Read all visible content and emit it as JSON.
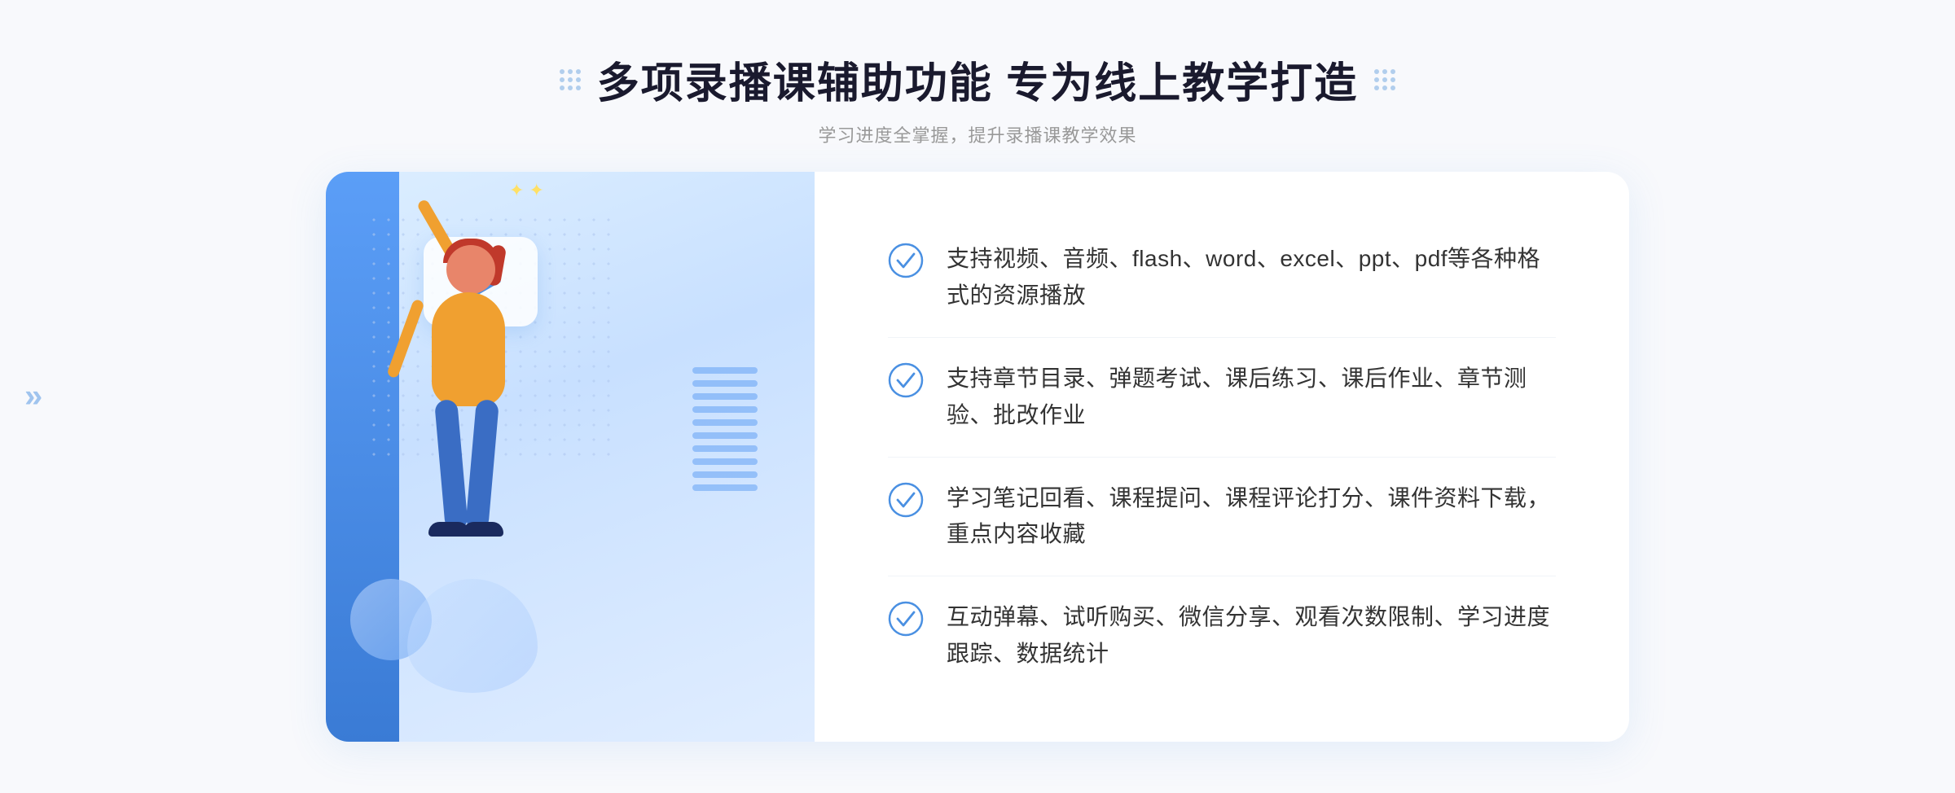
{
  "header": {
    "title": "多项录播课辅助功能 专为线上教学打造",
    "subtitle": "学习进度全掌握，提升录播课教学效果"
  },
  "features": [
    {
      "id": "feature-1",
      "text": "支持视频、音频、flash、word、excel、ppt、pdf等各种格式的资源播放"
    },
    {
      "id": "feature-2",
      "text": "支持章节目录、弹题考试、课后练习、课后作业、章节测验、批改作业"
    },
    {
      "id": "feature-3",
      "text": "学习笔记回看、课程提问、课程评论打分、课件资料下载，重点内容收藏"
    },
    {
      "id": "feature-4",
      "text": "互动弹幕、试听购买、微信分享、观看次数限制、学习进度跟踪、数据统计"
    }
  ],
  "colors": {
    "accent_blue": "#4a90e2",
    "title_dark": "#1a1a2e",
    "subtitle_gray": "#999999",
    "feature_text": "#333333",
    "bg_light": "#f8f9fc",
    "check_blue": "#4a90e2"
  },
  "decorators": {
    "left_chevron": "»",
    "right_dots_label": "dots-decorator"
  }
}
